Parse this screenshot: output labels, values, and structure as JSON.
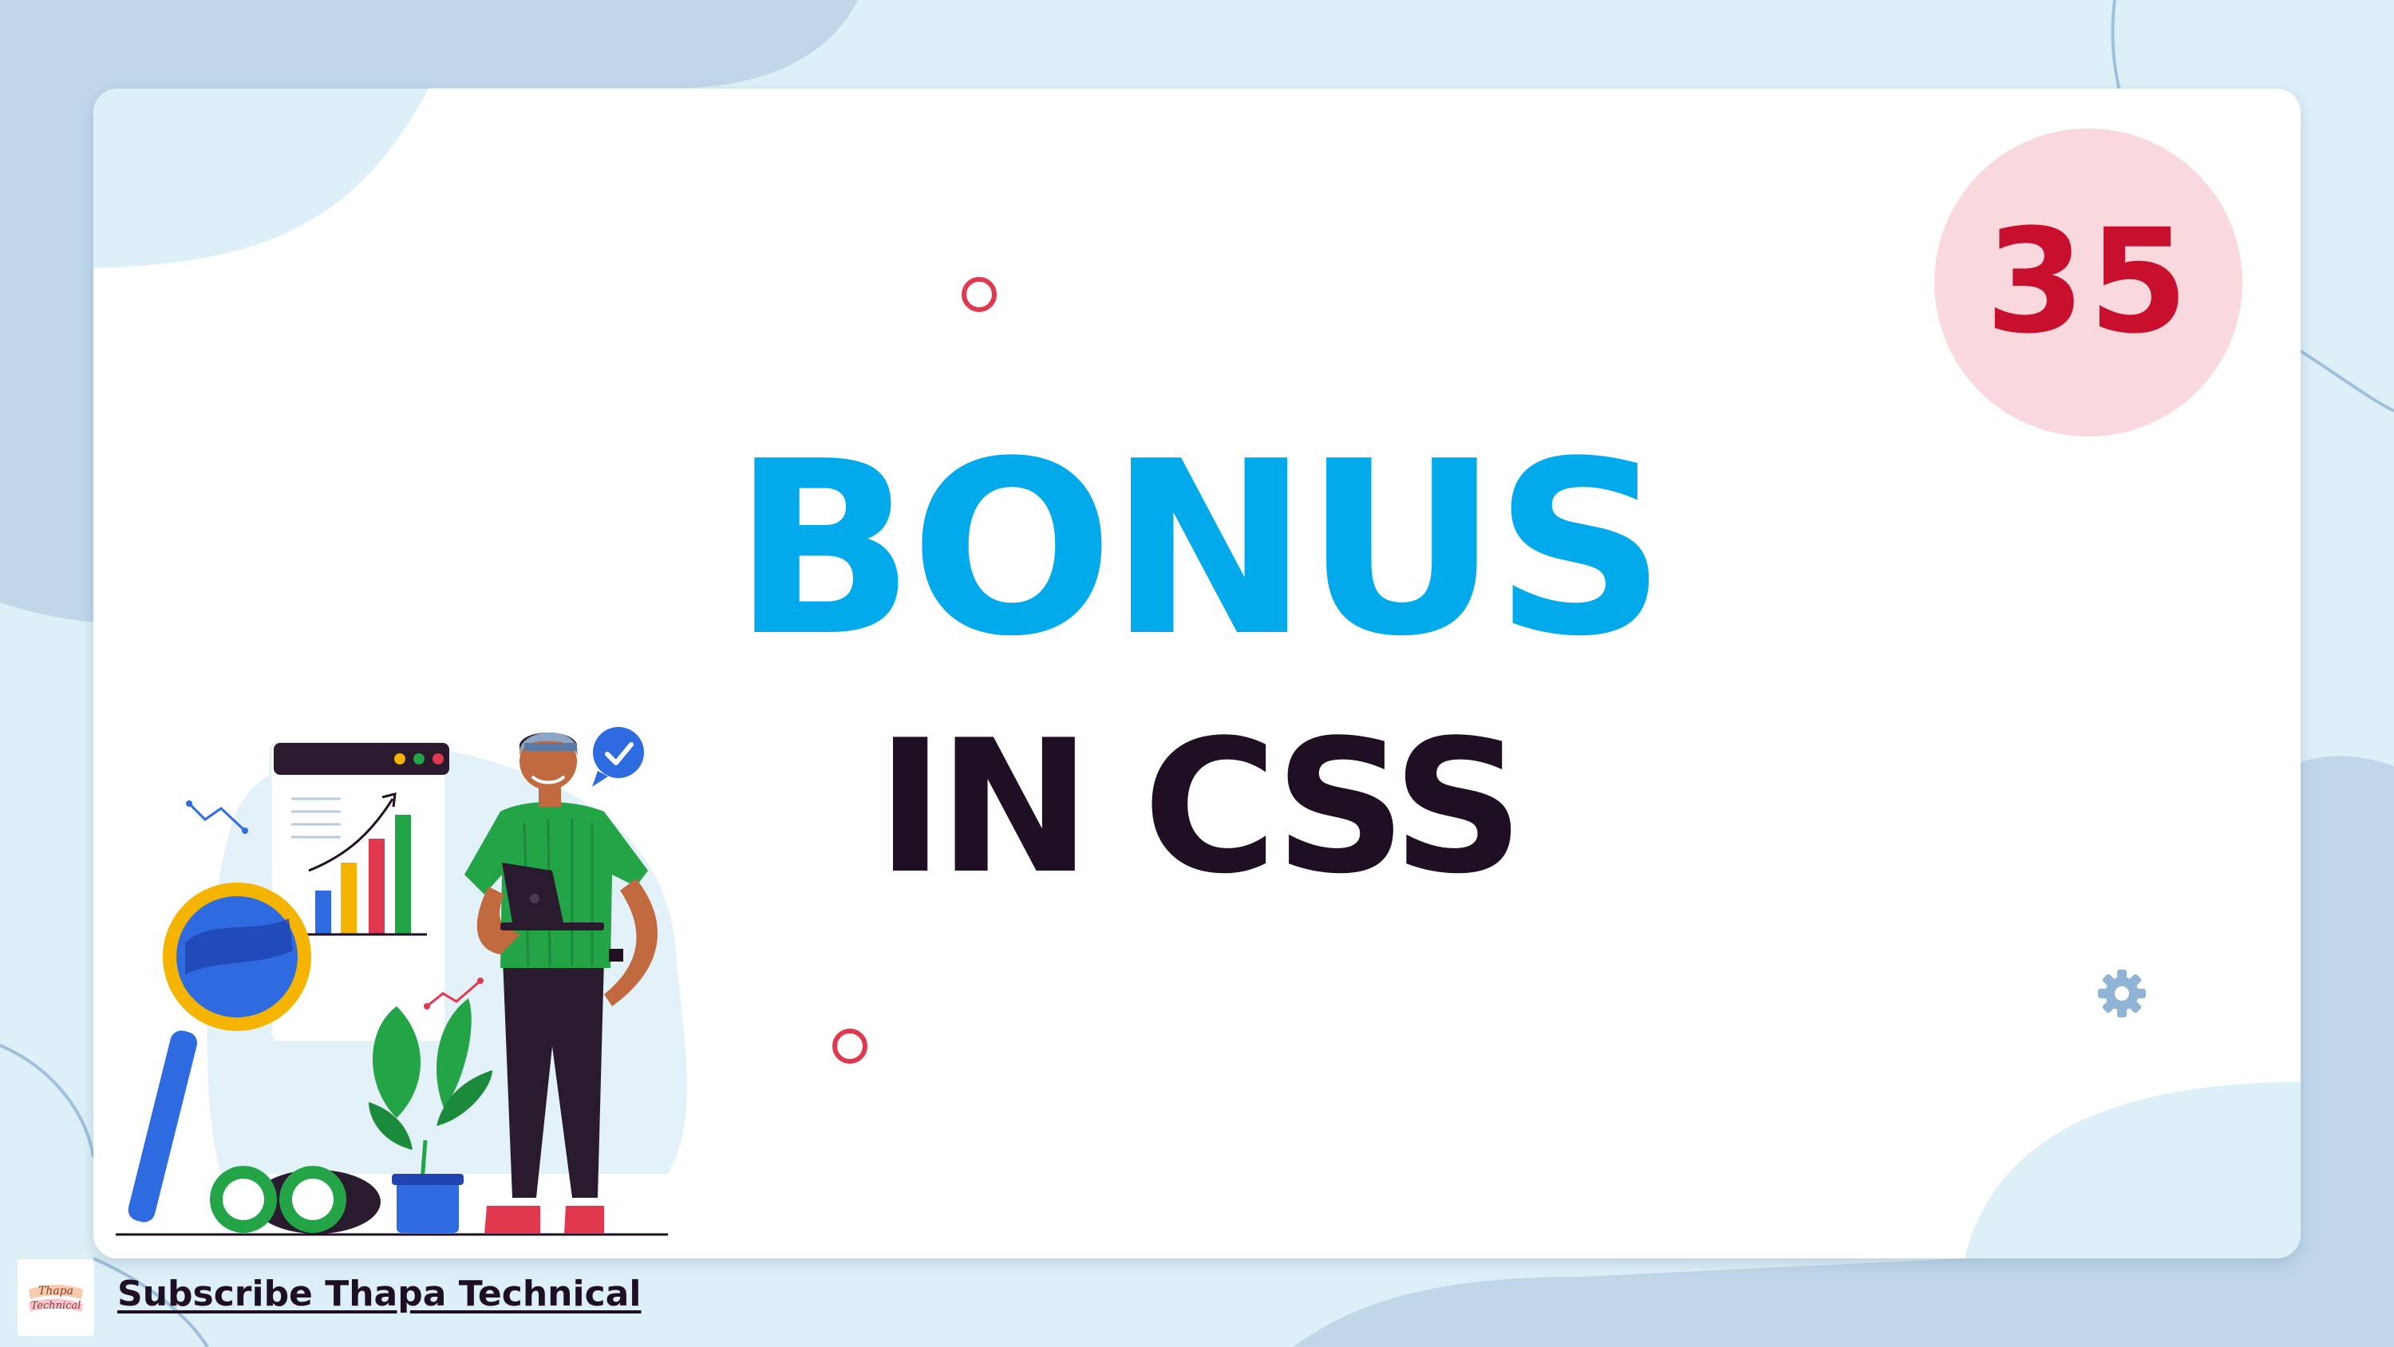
{
  "title": {
    "main": "BONUS",
    "sub": "IN CSS"
  },
  "episode": {
    "number": "35"
  },
  "footer": {
    "link_text": "Subscribe Thapa Technical",
    "logo_text_line1": "Thapa",
    "logo_text_line2": "Technical"
  },
  "colors": {
    "page_background": "#def0f7",
    "blob": "#c0d7ea",
    "card": "#ffffff",
    "title_main": "#03aaeb",
    "title_sub": "#1f0f22",
    "episode_circle": "#f9d9de",
    "episode_text": "#c8102e",
    "accent_ring": "#e0394f",
    "gear": "#8fb4d6"
  },
  "icons": [
    "gear-icon",
    "check-badge-icon",
    "magnifier-icon",
    "binoculars-icon",
    "bar-chart-icon",
    "laptop-icon",
    "plant-icon"
  ]
}
